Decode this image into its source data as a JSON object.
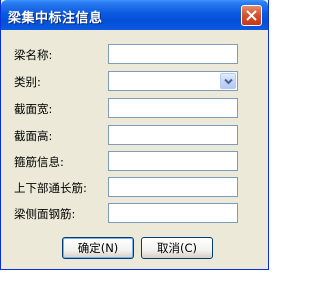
{
  "window": {
    "title": "梁集中标注信息",
    "close_icon": "close-icon"
  },
  "form": {
    "fields": [
      {
        "label": "梁名称:",
        "value": ""
      },
      {
        "label": "类别:",
        "value": ""
      },
      {
        "label": "截面宽:",
        "value": ""
      },
      {
        "label": "截面高:",
        "value": ""
      },
      {
        "label": "箍筋信息:",
        "value": ""
      },
      {
        "label": "上下部通长筋:",
        "value": ""
      },
      {
        "label": "梁侧面钢筋:",
        "value": ""
      }
    ]
  },
  "buttons": {
    "ok_label": "确定(N)",
    "cancel_label": "取消(C)"
  },
  "colors": {
    "title_bar": "#0a5ae0",
    "close_button": "#d5502b",
    "dialog_bg": "#ece9d8",
    "field_border": "#7f9db9"
  }
}
